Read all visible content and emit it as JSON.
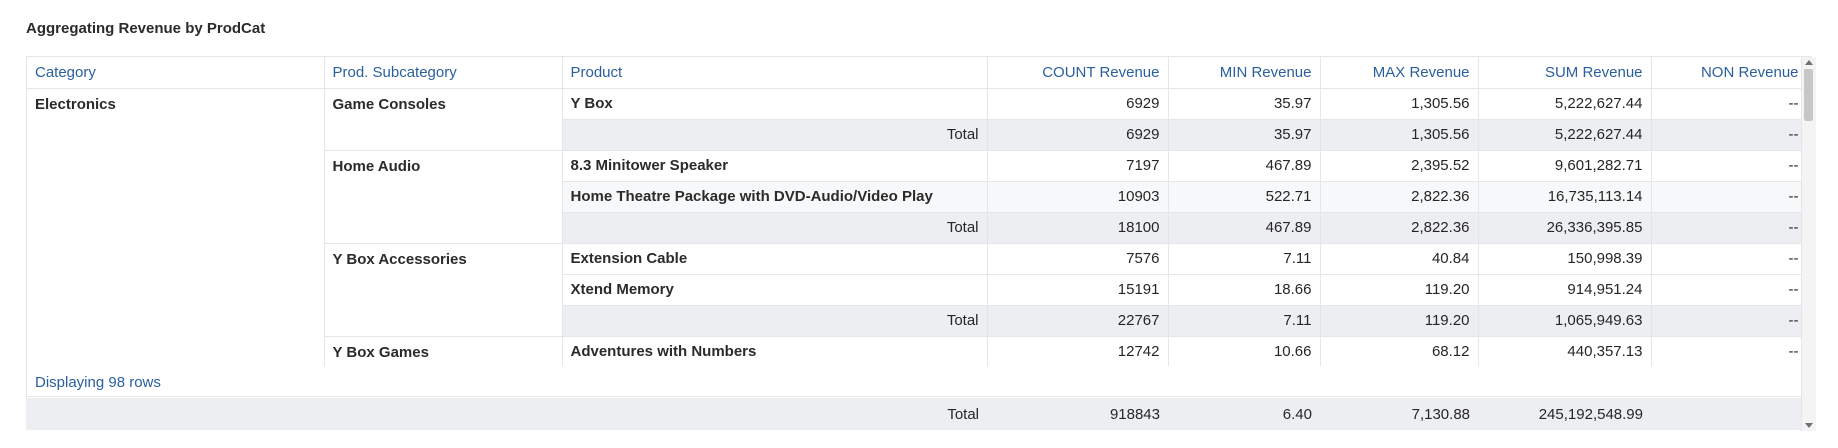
{
  "title": "Aggregating Revenue by ProdCat",
  "columns": [
    "Category",
    "Prod. Subcategory",
    "Product",
    "COUNT Revenue",
    "MIN Revenue",
    "MAX Revenue",
    "SUM Revenue",
    "NON Revenue"
  ],
  "category": "Electronics",
  "subcats": [
    {
      "name": "Game Consoles",
      "rows": [
        {
          "product": "Y Box",
          "count": "6929",
          "min": "35.97",
          "max": "1,305.56",
          "sum": "5,222,627.44",
          "non": "--"
        }
      ],
      "total": {
        "label": "Total",
        "count": "6929",
        "min": "35.97",
        "max": "1,305.56",
        "sum": "5,222,627.44",
        "non": "--"
      }
    },
    {
      "name": "Home Audio",
      "rows": [
        {
          "product": "8.3 Minitower Speaker",
          "count": "7197",
          "min": "467.89",
          "max": "2,395.52",
          "sum": "9,601,282.71",
          "non": "--"
        },
        {
          "product": "Home Theatre Package with DVD-Audio/Video Play",
          "count": "10903",
          "min": "522.71",
          "max": "2,822.36",
          "sum": "16,735,113.14",
          "non": "--"
        }
      ],
      "total": {
        "label": "Total",
        "count": "18100",
        "min": "467.89",
        "max": "2,822.36",
        "sum": "26,336,395.85",
        "non": "--"
      }
    },
    {
      "name": "Y Box Accessories",
      "rows": [
        {
          "product": "Extension Cable",
          "count": "7576",
          "min": "7.11",
          "max": "40.84",
          "sum": "150,998.39",
          "non": "--"
        },
        {
          "product": "Xtend Memory",
          "count": "15191",
          "min": "18.66",
          "max": "119.20",
          "sum": "914,951.24",
          "non": "--"
        }
      ],
      "total": {
        "label": "Total",
        "count": "22767",
        "min": "7.11",
        "max": "119.20",
        "sum": "1,065,949.63",
        "non": "--"
      }
    },
    {
      "name": "Y Box Games",
      "rows": [
        {
          "product": "Adventures with Numbers",
          "count": "12742",
          "min": "10.66",
          "max": "68.12",
          "sum": "440,357.13",
          "non": "--"
        }
      ]
    }
  ],
  "footer": {
    "rows_text": "Displaying 98 rows"
  },
  "grand_total": {
    "label": "Total",
    "count": "918843",
    "min": "6.40",
    "max": "7,130.88",
    "sum": "245,192,548.99"
  }
}
